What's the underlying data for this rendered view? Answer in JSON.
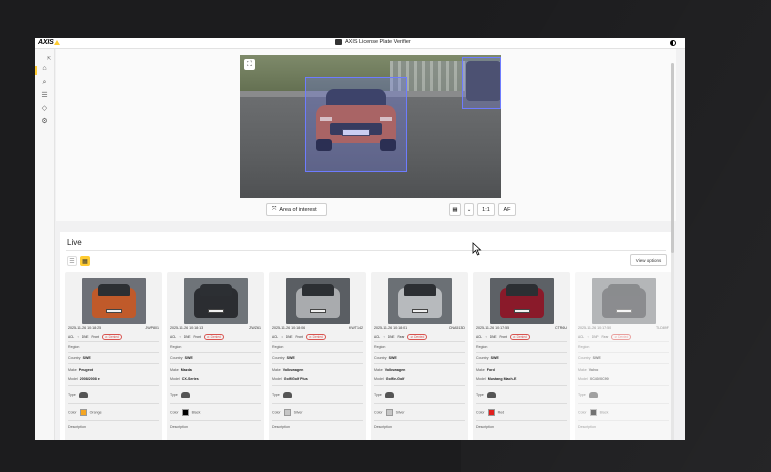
{
  "app": {
    "logo": "AXIS",
    "title": "AXIS License Plate Verifier",
    "colors": {
      "accent": "#ffcc33",
      "denied": "#d9534f",
      "bbox": "#6e7cff"
    }
  },
  "sidebar": {
    "items": [
      {
        "name": "home-icon",
        "glyph": "⌂"
      },
      {
        "name": "search-icon",
        "glyph": "⌕"
      },
      {
        "name": "list-icon",
        "glyph": "☰"
      },
      {
        "name": "region-icon",
        "glyph": "◇"
      },
      {
        "name": "gear-icon",
        "glyph": "⚙"
      }
    ]
  },
  "video": {
    "aoi_label": "Area of interest",
    "controls": [
      "▦",
      "⌄",
      "1:1",
      "AF"
    ]
  },
  "live": {
    "title": "Live",
    "view_options": "View options"
  },
  "cards": [
    {
      "timestamp": "2025-11-26 10:18:25",
      "plate": "JWP801",
      "acl": "ACL",
      "direction": "↑",
      "list": "DNE",
      "front": "Front",
      "status": "Denied",
      "region": "",
      "country": "SWE",
      "make": "Peugeot",
      "model": "2008/2008 e",
      "color_name": "Orange",
      "color_hex": "#f5a623",
      "car_color": "#c05a2a",
      "bg": "#6d7077",
      "dim": false
    },
    {
      "timestamp": "2025-11-26 10:18:13",
      "plate": "ZWZ61",
      "acl": "ACL",
      "direction": "↑",
      "list": "DNE",
      "front": "Front",
      "status": "Denied",
      "region": "",
      "country": "SWE",
      "make": "Mazda",
      "model": "CX-Series",
      "color_name": "Black",
      "color_hex": "#000000",
      "car_color": "#2b2d31",
      "bg": "#6f7479",
      "dim": false
    },
    {
      "timestamp": "2025-11-26 10:18:06",
      "plate": "KWT142",
      "acl": "ACL",
      "direction": "↕",
      "list": "DNE",
      "front": "Front",
      "status": "Denied",
      "region": "",
      "country": "SWE",
      "make": "Volkswagen",
      "model": "Golf/Golf Plus",
      "color_name": "Silver",
      "color_hex": "#c6c6c6",
      "car_color": "#a9abae",
      "bg": "#5a5e63",
      "dim": false
    },
    {
      "timestamp": "2025-11-26 10:18:01",
      "plate": "CNA513D",
      "acl": "ACL",
      "direction": "↑",
      "list": "DNE",
      "front": "Rear",
      "status": "Denied",
      "region": "",
      "country": "SWE",
      "make": "Volkswagen",
      "model": "Golf/e-Golf",
      "color_name": "Silver",
      "color_hex": "#c6c6c6",
      "car_color": "#b7babd",
      "bg": "#6b7075",
      "dim": false
    },
    {
      "timestamp": "2025-11-26 10:17:55",
      "plate": "CTR6U",
      "acl": "ACL",
      "direction": "↑",
      "list": "DNE",
      "front": "Front",
      "status": "Denied",
      "region": "",
      "country": "SWE",
      "make": "Ford",
      "model": "Mustang Mach-E",
      "color_name": "Red",
      "color_hex": "#e0201e",
      "car_color": "#8a1a2a",
      "bg": "#5d6166",
      "dim": false
    },
    {
      "timestamp": "2025-11-26 10:17:50",
      "plate": "TLD89F",
      "acl": "ACL",
      "direction": "↑",
      "list": "DNP",
      "front": "Rear",
      "status": "Denied",
      "region": "",
      "country": "SWE",
      "make": "Volvo",
      "model": "XC40/XC90",
      "color_name": "Black",
      "color_hex": "#000000",
      "car_color": "#2d3034",
      "bg": "#777b7f",
      "dim": true
    }
  ],
  "labels": {
    "region": "Region",
    "country": "Country",
    "make": "Make",
    "model": "Model",
    "type": "Type",
    "color": "Color",
    "description": "Description"
  }
}
